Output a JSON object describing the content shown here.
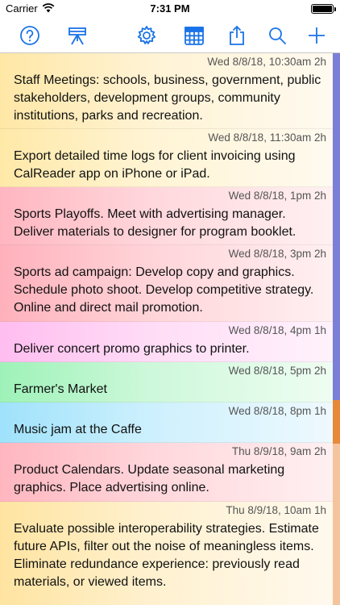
{
  "status_bar": {
    "carrier": "Carrier",
    "time": "7:31 PM"
  },
  "toolbar": {
    "accent_color": "#1a73e8",
    "buttons": [
      {
        "name": "help",
        "icon": "question-circle-icon"
      },
      {
        "name": "easel",
        "icon": "easel-icon"
      },
      {
        "name": "settings",
        "icon": "gear-icon"
      },
      {
        "name": "calendar",
        "icon": "calendar-grid-icon"
      },
      {
        "name": "share",
        "icon": "share-icon"
      },
      {
        "name": "search",
        "icon": "search-icon"
      },
      {
        "name": "add",
        "icon": "plus-icon"
      }
    ]
  },
  "events": [
    {
      "when": "Wed 8/8/18, 10:30am 2h",
      "title": "Staff Meetings: schools, business, government, public stakeholders, development groups, community institutions, parks and recreation.",
      "color": "#ffe7a6"
    },
    {
      "when": "Wed 8/8/18, 11:30am 2h",
      "title": "Export detailed time logs for client invoicing using CalReader app on iPhone or iPad.",
      "color": "#ffe9a8"
    },
    {
      "when": "Wed 8/8/18, 1pm 2h",
      "title": "Sports Playoffs. Meet with advertising manager. Deliver materials to designer for program booklet.",
      "color": "#ffb6c0"
    },
    {
      "when": "Wed 8/8/18, 3pm 2h",
      "title": "Sports ad campaign: Develop copy and graphics. Schedule photo shoot. Develop competitive strategy. Online and direct mail promotion.",
      "color": "#ffb1bb"
    },
    {
      "when": "Wed 8/8/18, 4pm 1h",
      "title": "Deliver concert promo graphics to printer.",
      "color": "#ffbdf0"
    },
    {
      "when": "Wed 8/8/18, 5pm 2h",
      "title": "Farmer's Market",
      "color": "#9ef2b8"
    },
    {
      "when": "Wed 8/8/18, 8pm 1h",
      "title": "Music jam at the Caffe",
      "color": "#9fe2fb"
    },
    {
      "when": "Thu 8/9/18, 9am 2h",
      "title": "Product Calendars. Update seasonal marketing graphics. Place advertising online.",
      "color": "#ffb6bf"
    },
    {
      "when": "Thu 8/9/18, 10am 1h",
      "title": "Evaluate possible interoperability strategies. Estimate future APIs, filter out the noise of meaningless items. Eliminate redundance experience: previously read materials, or viewed items.",
      "color": "#ffe4a1"
    }
  ],
  "side_strip_colors": [
    "#7b7fd6",
    "#e8893a",
    "#f6c49c"
  ]
}
